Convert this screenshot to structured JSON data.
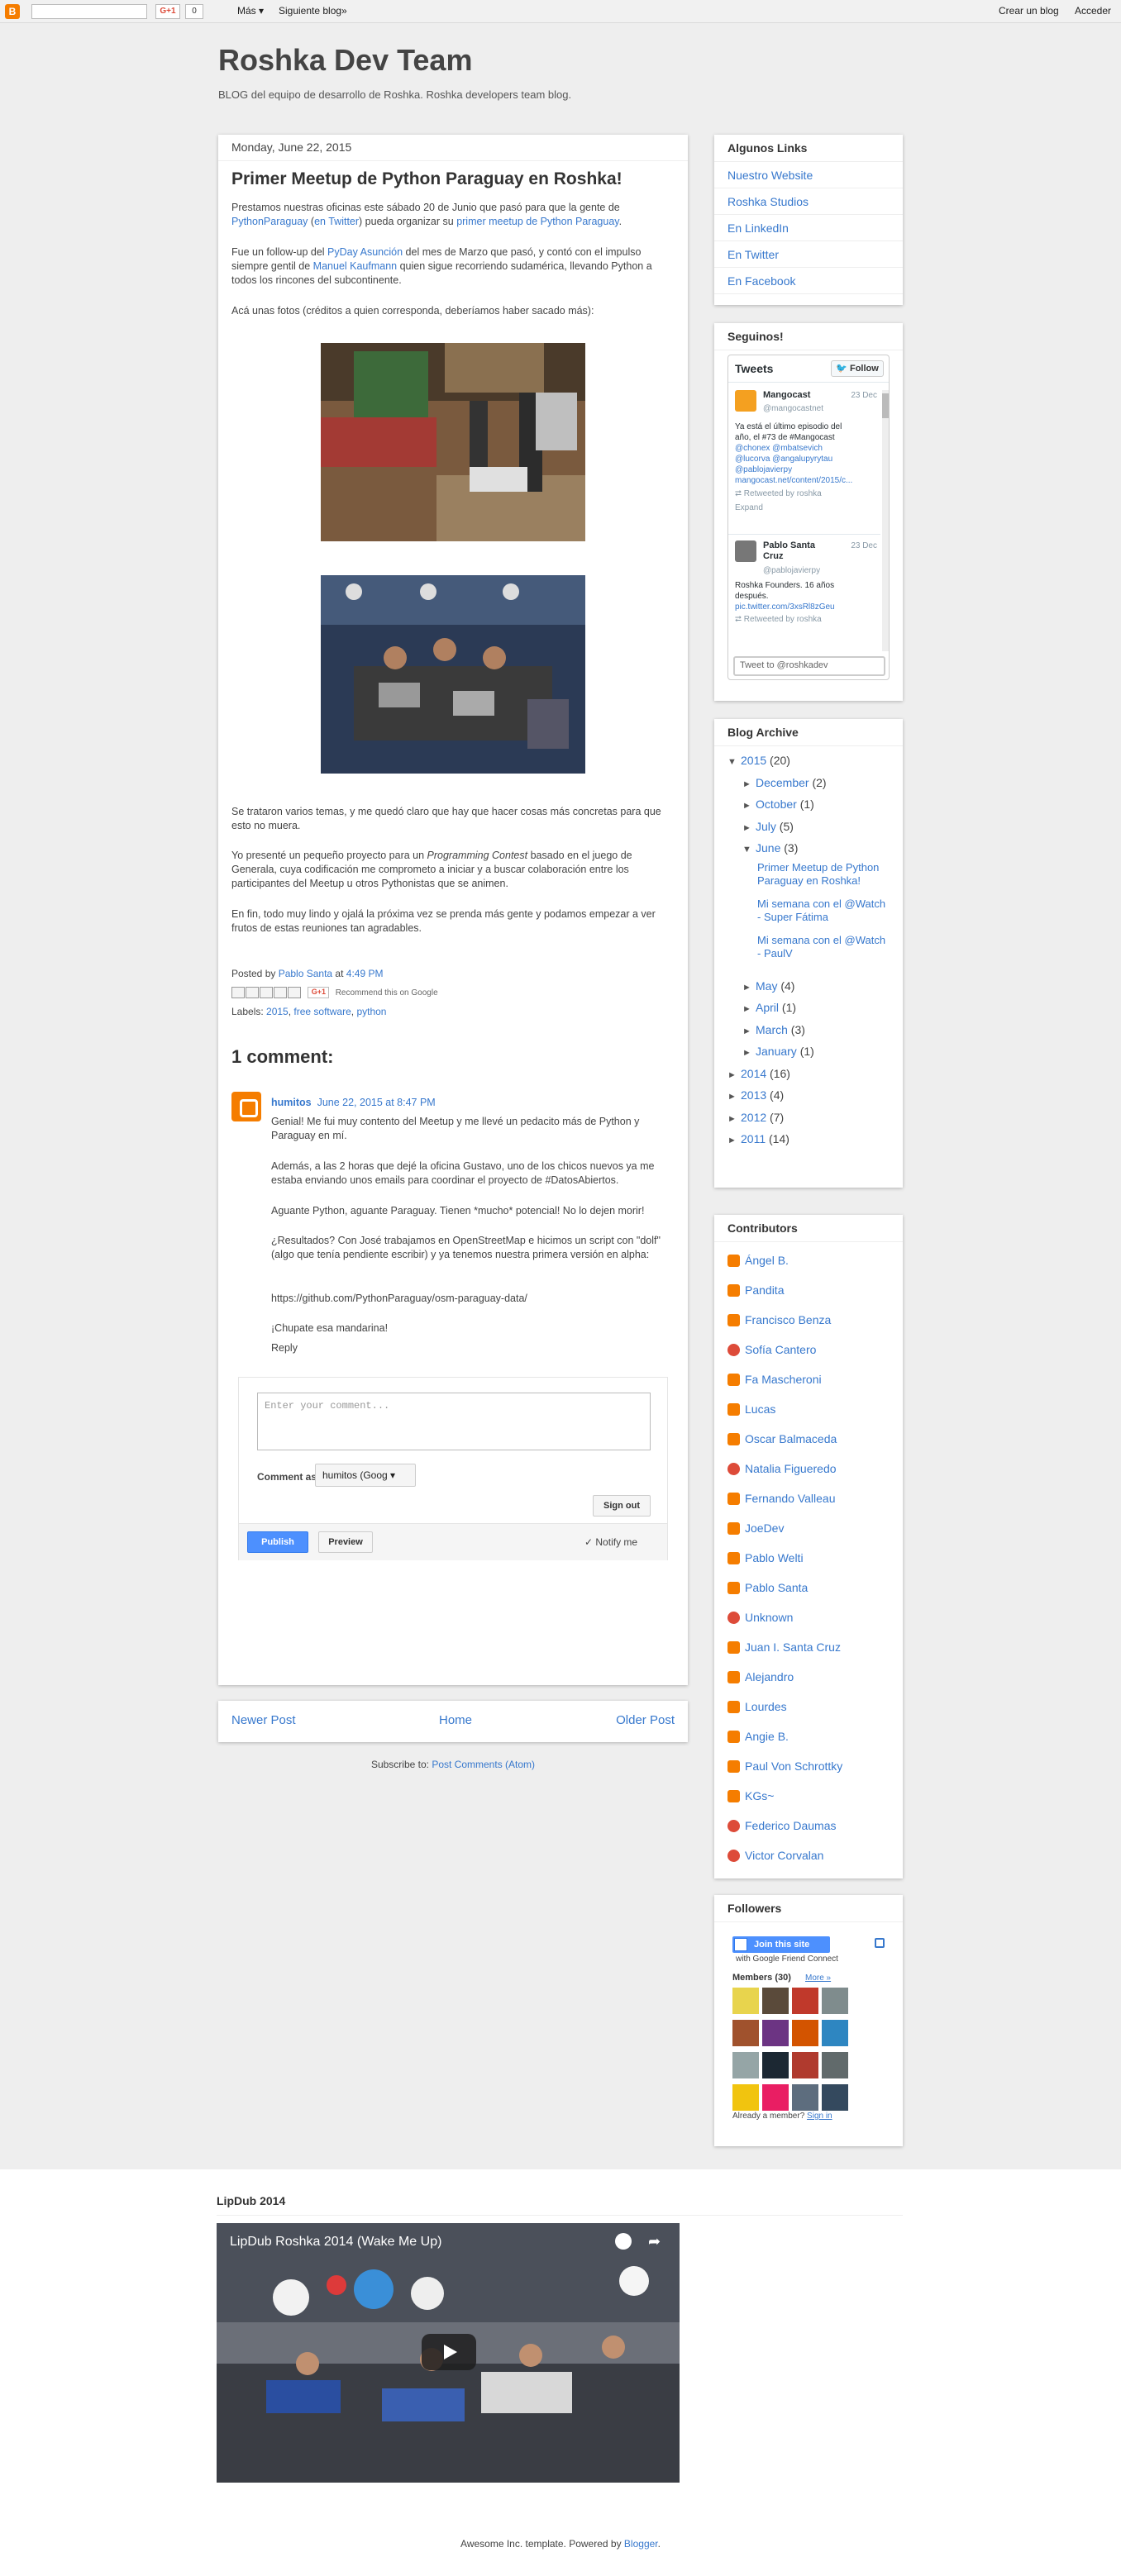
{
  "navbar": {
    "blogger_logo": "B",
    "gplus": "G+1",
    "gplus_count": "0",
    "mas": "Más ▾",
    "next_blog": "Siguiente blog»",
    "create_blog": "Crear un blog",
    "signin": "Acceder"
  },
  "header": {
    "title": "Roshka Dev Team",
    "description": "BLOG del equipo de desarrollo de Roshka. Roshka developers team blog."
  },
  "post": {
    "date": "Monday, June 22, 2015",
    "title": "Primer Meetup de Python Paraguay en Roshka!",
    "p1": {
      "a": "Prestamos nuestras oficinas este sábado 20 de Junio que pasó para que la gente de ",
      "link1": "PythonParaguay",
      "b": " (",
      "link2": "en Twitter",
      "c": ") pueda organizar su ",
      "link3": "primer meetup de Python Paraguay",
      "d": "."
    },
    "p2": {
      "a": "Fue un follow-up del ",
      "link1": "PyDay Asunción",
      "b": " del mes de Marzo que pasó, y contó con el impulso siempre gentil de ",
      "link2": "Manuel Kaufmann",
      "c": " quien sigue recorriendo sudamérica, llevando Python a todos los rincones del subcontinente."
    },
    "p3": "Acá unas fotos (créditos a quien corresponda, deberíamos haber sacado más):",
    "p4": "Se trataron varios temas, y me quedó claro que hay que hacer cosas más concretas para que esto no muera.",
    "p5": {
      "a": "Yo presenté un pequeño proyecto para un ",
      "em": "Programming Contest",
      "b": " basado en el juego de Generala, cuya codificación me comprometo a iniciar y a buscar colaboración entre los participantes del Meetup u otros Pythonistas que se animen."
    },
    "p6": "En fin, todo muy lindo y ojalá la próxima vez se prenda más gente y podamos empezar a ver frutos de estas reuniones tan agradables.",
    "posted_by": "Posted by ",
    "author": "Pablo Santa",
    "at": " at ",
    "time": "4:49 PM",
    "recommend": "Recommend this on Google",
    "labels_prefix": "Labels: ",
    "labels": [
      "2015",
      "free software",
      "python"
    ]
  },
  "comments": {
    "heading": "1 comment:",
    "items": [
      {
        "author": "humitos",
        "date": "June 22, 2015 at 8:47 PM",
        "p1": "Genial! Me fui muy contento del Meetup y me llevé un pedacito más de Python y Paraguay en mí.",
        "p2": "Además, a las 2 horas que dejé la oficina Gustavo, uno de los chicos nuevos ya me estaba enviando unos emails para coordinar el proyecto de #DatosAbiertos.",
        "p3": "Aguante Python, aguante Paraguay. Tienen *mucho* potencial! No lo dejen morir!",
        "p4": "¿Resultados? Con José trabajamos en OpenStreetMap e hicimos un script con \"dolf\" (algo que tenía pendiente escribir) y ya tenemos nuestra primera versión en alpha:",
        "p5": "https://github.com/PythonParaguay/osm-paraguay-data/",
        "p6": "¡Chupate esa mandarina!",
        "reply": "Reply"
      }
    ],
    "form": {
      "placeholder": "Enter your comment...",
      "comment_as": "Comment as:",
      "identity": "humitos (Goog ▾",
      "sign_out": "Sign out",
      "publish": "Publish",
      "preview": "Preview",
      "notify": "✓  Notify me"
    }
  },
  "pager": {
    "newer": "Newer Post",
    "home": "Home",
    "older": "Older Post"
  },
  "subscribe": {
    "text": "Subscribe to: ",
    "link": "Post Comments (Atom)"
  },
  "sidebar": {
    "links": {
      "title": "Algunos Links",
      "items": [
        "Nuestro Website",
        "Roshka Studios",
        "En LinkedIn",
        "En Twitter",
        "En Facebook"
      ]
    },
    "follow": {
      "title": "Seguinos!",
      "tweets_label": "Tweets",
      "follow_btn": "Follow",
      "tweet_to": "Tweet to @roshkadev",
      "tweets": [
        {
          "name": "Mangocast",
          "handle": "@mangocastnet",
          "date": "23 Dec",
          "lines": [
            "Ya está el último episodio del",
            "año, el #73 de #Mangocast",
            "@chonex @mbatsevich",
            "@lucorva @angalupyrytau",
            "@pablojavierpy",
            "mangocast.net/content/2015/c..."
          ],
          "rt": "Retweeted by roshka",
          "expand": "Expand"
        },
        {
          "name": "Pablo Santa",
          "name2": "Cruz",
          "handle": "@pablojavierpy",
          "date": "23 Dec",
          "lines": [
            "Roshka Founders. 16 años",
            "después.",
            "pic.twitter.com/3xsRl8zGeu"
          ],
          "rt": "Retweeted by roshka"
        }
      ]
    },
    "archive": {
      "title": "Blog Archive",
      "rows": [
        {
          "tri": "▼",
          "label": "2015",
          "count": "(20)",
          "indent": 0
        },
        {
          "tri": "►",
          "label": "December",
          "count": "(2)",
          "indent": 1
        },
        {
          "tri": "►",
          "label": "October",
          "count": "(1)",
          "indent": 1
        },
        {
          "tri": "►",
          "label": "July",
          "count": "(5)",
          "indent": 1
        },
        {
          "tri": "▼",
          "label": "June",
          "count": "(3)",
          "indent": 1
        }
      ],
      "june_posts": [
        "Primer Meetup de Python Paraguay en Roshka!",
        "Mi semana con el @Watch - Super Fátima",
        "Mi semana con el @Watch - PaulV"
      ],
      "rows2": [
        {
          "tri": "►",
          "label": "May",
          "count": "(4)",
          "indent": 1
        },
        {
          "tri": "►",
          "label": "April",
          "count": "(1)",
          "indent": 1
        },
        {
          "tri": "►",
          "label": "March",
          "count": "(3)",
          "indent": 1
        },
        {
          "tri": "►",
          "label": "January",
          "count": "(1)",
          "indent": 1
        },
        {
          "tri": "►",
          "label": "2014",
          "count": "(16)",
          "indent": 0
        },
        {
          "tri": "►",
          "label": "2013",
          "count": "(4)",
          "indent": 0
        },
        {
          "tri": "►",
          "label": "2012",
          "count": "(7)",
          "indent": 0
        },
        {
          "tri": "►",
          "label": "2011",
          "count": "(14)",
          "indent": 0
        }
      ]
    },
    "contributors": {
      "title": "Contributors",
      "items": [
        {
          "name": "Ángel B.",
          "icon": "b"
        },
        {
          "name": "Pandita",
          "icon": "b"
        },
        {
          "name": "Francisco Benza",
          "icon": "b"
        },
        {
          "name": "Sofía Cantero",
          "icon": "g"
        },
        {
          "name": "Fa Mascheroni",
          "icon": "b"
        },
        {
          "name": "Lucas",
          "icon": "b"
        },
        {
          "name": "Oscar Balmaceda",
          "icon": "b"
        },
        {
          "name": "Natalia Figueredo",
          "icon": "g"
        },
        {
          "name": "Fernando Valleau",
          "icon": "b"
        },
        {
          "name": "JoeDev",
          "icon": "b"
        },
        {
          "name": "Pablo Welti",
          "icon": "b"
        },
        {
          "name": "Pablo Santa",
          "icon": "b"
        },
        {
          "name": "Unknown",
          "icon": "g"
        },
        {
          "name": "Juan I. Santa Cruz",
          "icon": "b"
        },
        {
          "name": "Alejandro",
          "icon": "b"
        },
        {
          "name": "Lourdes",
          "icon": "b"
        },
        {
          "name": "Angie B.",
          "icon": "b"
        },
        {
          "name": "Paul Von Schrottky",
          "icon": "b"
        },
        {
          "name": "KGs~",
          "icon": "b"
        },
        {
          "name": "Federico Daumas",
          "icon": "g"
        },
        {
          "name": "Victor Corvalan",
          "icon": "g"
        }
      ]
    },
    "followers": {
      "title": "Followers",
      "join": "Join this site",
      "gfc": "with Google Friend Connect",
      "members": "Members (30)",
      "more": "More »",
      "already": "Already a member? ",
      "signin": "Sign in"
    }
  },
  "lipdub": {
    "heading": "LipDub 2014",
    "video_title": "LipDub Roshka 2014 (Wake Me Up)"
  },
  "footer": {
    "text": "Awesome Inc. template. Powered by ",
    "link": "Blogger",
    "end": "."
  }
}
